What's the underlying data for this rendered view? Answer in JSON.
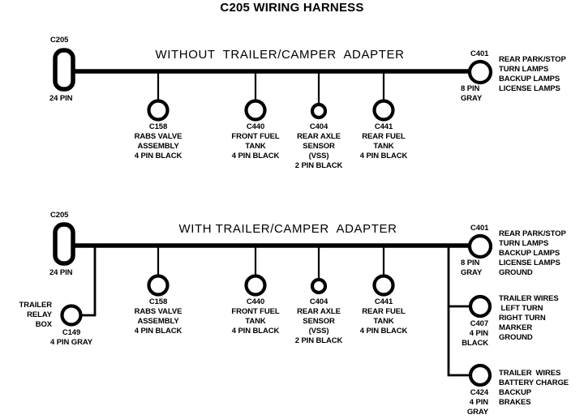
{
  "document": {
    "title": "C205 WIRING HARNESS",
    "stroke_color": "#000000",
    "background_color": "#ffffff"
  },
  "diagrams": [
    {
      "id": "without-adapter",
      "title": "WITHOUT  TRAILER/CAMPER  ADAPTER",
      "source_connector": {
        "id": "C205",
        "label": "C205",
        "pins": "24 PIN",
        "shape": "rounded-rect"
      },
      "end_connector": {
        "id": "C401",
        "label": "C401",
        "pins": "8 PIN",
        "color": "GRAY",
        "circuits": [
          "REAR PARK/STOP",
          "TURN LAMPS",
          "BACKUP LAMPS",
          "LICENSE LAMPS"
        ]
      },
      "branches": [
        {
          "id": "C158",
          "label": "C158",
          "lines": [
            "RABS VALVE",
            "ASSEMBLY",
            "4 PIN BLACK"
          ],
          "size": "large"
        },
        {
          "id": "C440",
          "label": "C440",
          "lines": [
            "FRONT FUEL",
            "TANK",
            "4 PIN BLACK"
          ],
          "size": "large"
        },
        {
          "id": "C404",
          "label": "C404",
          "lines": [
            "REAR AXLE",
            "SENSOR",
            "(VSS)",
            "2 PIN BLACK"
          ],
          "size": "small"
        },
        {
          "id": "C441",
          "label": "C441",
          "lines": [
            "REAR FUEL",
            "TANK",
            "4 PIN BLACK"
          ],
          "size": "large"
        }
      ]
    },
    {
      "id": "with-adapter",
      "title": "WITH TRAILER/CAMPER  ADAPTER",
      "source_connector": {
        "id": "C205",
        "label": "C205",
        "pins": "24 PIN",
        "shape": "rounded-rect"
      },
      "end_connector": {
        "id": "C401",
        "label": "C401",
        "pins": "8 PIN",
        "color": "GRAY",
        "circuits": [
          "REAR PARK/STOP",
          "TURN LAMPS",
          "BACKUP LAMPS",
          "LICENSE LAMPS",
          "GROUND"
        ]
      },
      "left_branch": {
        "id": "C149",
        "label": "C149",
        "name_lines": [
          "TRAILER",
          "RELAY",
          "BOX"
        ],
        "pins_line": "4 PIN GRAY"
      },
      "branches": [
        {
          "id": "C158",
          "label": "C158",
          "lines": [
            "RABS VALVE",
            "ASSEMBLY",
            "4 PIN BLACK"
          ],
          "size": "large"
        },
        {
          "id": "C440",
          "label": "C440",
          "lines": [
            "FRONT FUEL",
            "TANK",
            "4 PIN BLACK"
          ],
          "size": "large"
        },
        {
          "id": "C404",
          "label": "C404",
          "lines": [
            "REAR AXLE",
            "SENSOR",
            "(VSS)",
            "2 PIN BLACK"
          ],
          "size": "small"
        },
        {
          "id": "C441",
          "label": "C441",
          "lines": [
            "REAR FUEL",
            "TANK",
            "4 PIN BLACK"
          ],
          "size": "large"
        }
      ],
      "trailer_connectors": [
        {
          "id": "C407",
          "label": "C407",
          "pins": "4 PIN",
          "color": "BLACK",
          "circuits": [
            "TRAILER WIRES",
            " LEFT TURN",
            "RIGHT TURN",
            "MARKER",
            "GROUND"
          ]
        },
        {
          "id": "C424",
          "label": "C424",
          "pins": "4 PIN",
          "color": "GRAY",
          "circuits": [
            "TRAILER  WIRES",
            "BATTERY CHARGE",
            "BACKUP",
            "BRAKES"
          ]
        }
      ]
    }
  ]
}
